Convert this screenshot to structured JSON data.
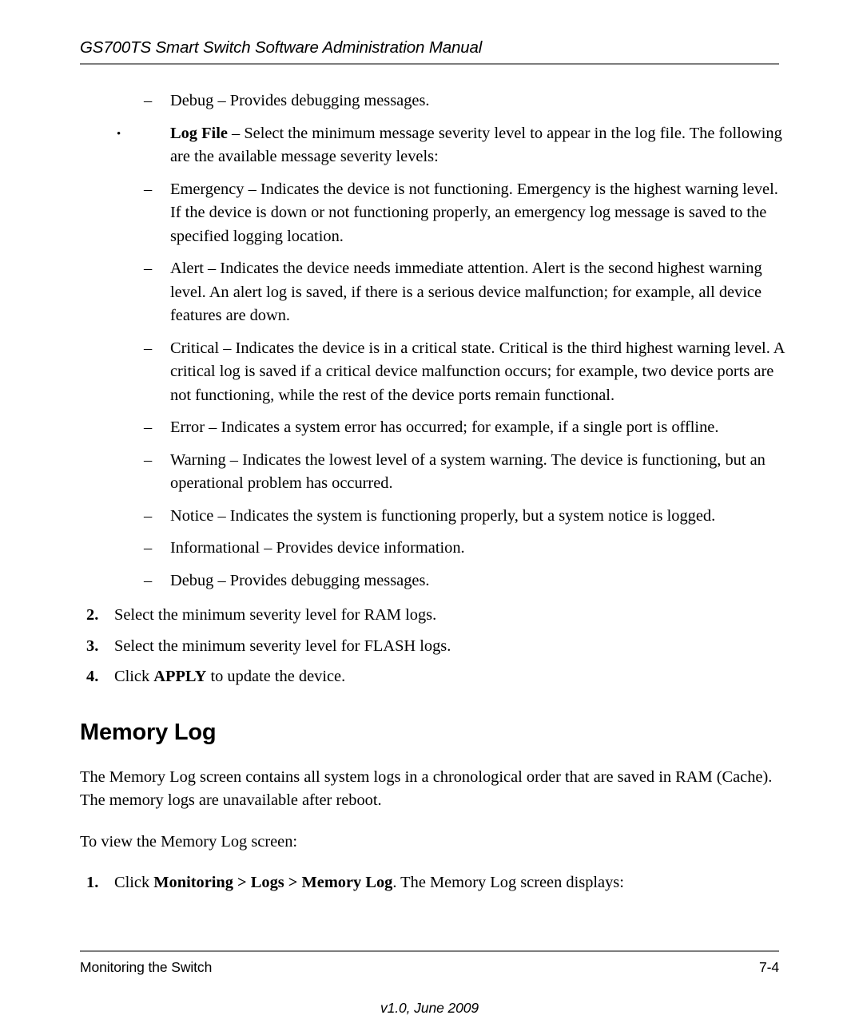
{
  "header": {
    "title": "GS700TS Smart Switch Software Administration Manual"
  },
  "content": {
    "top_dash_item": {
      "marker": "–",
      "text": "Debug – Provides debugging messages."
    },
    "log_file_bullet": {
      "marker": "•",
      "bold_lead": "Log File",
      "text": " – Select the minimum message severity level to appear in the log file. The following are the available message severity levels:"
    },
    "severity_levels": [
      {
        "marker": "–",
        "text": "Emergency – Indicates the device is not functioning. Emergency is the highest warning level. If the device is down or not functioning properly, an emergency log message is saved to the specified logging location."
      },
      {
        "marker": "–",
        "text": "Alert – Indicates the device needs immediate attention. Alert is the second highest warning level. An alert log is saved, if there is a serious device malfunction; for example, all device features are down."
      },
      {
        "marker": "–",
        "text": "Critical – Indicates the device is in a critical state. Critical is the third highest warning level. A critical log is saved if a critical device malfunction occurs; for example, two device ports are not functioning, while the rest of the device ports remain functional."
      },
      {
        "marker": "–",
        "text": "Error – Indicates a system error has occurred; for example, if a single port is offline."
      },
      {
        "marker": "–",
        "text": "Warning – Indicates the lowest level of a system warning. The device is functioning, but an operational problem has occurred."
      },
      {
        "marker": "–",
        "text": "Notice – Indicates the system is functioning properly, but a system notice is logged."
      },
      {
        "marker": "–",
        "text": "Informational – Provides device information."
      },
      {
        "marker": "–",
        "text": "Debug – Provides debugging messages."
      }
    ],
    "steps": [
      {
        "marker": "2.",
        "text": "Select the minimum severity level for RAM logs."
      },
      {
        "marker": "3.",
        "text": "Select the minimum severity level for FLASH logs."
      }
    ],
    "step_apply": {
      "marker": "4.",
      "prefix": "Click ",
      "bold": "APPLY",
      "suffix": " to update the device."
    },
    "section_heading": "Memory Log",
    "intro_paragraph": "The Memory Log screen contains all system logs in a chronological order that are saved in RAM (Cache). The memory logs are unavailable after reboot.",
    "to_view_paragraph": "To view the Memory Log screen:",
    "step_one": {
      "marker": "1.",
      "prefix": "Click ",
      "bold": "Monitoring > Logs > Memory Log",
      "suffix": ". The Memory Log screen displays:"
    }
  },
  "footer": {
    "left": "Monitoring the Switch",
    "right": "7-4",
    "version": "v1.0, June 2009"
  },
  "colors": {
    "rule": "#7d7d7d",
    "text": "#000000",
    "background": "#ffffff"
  }
}
